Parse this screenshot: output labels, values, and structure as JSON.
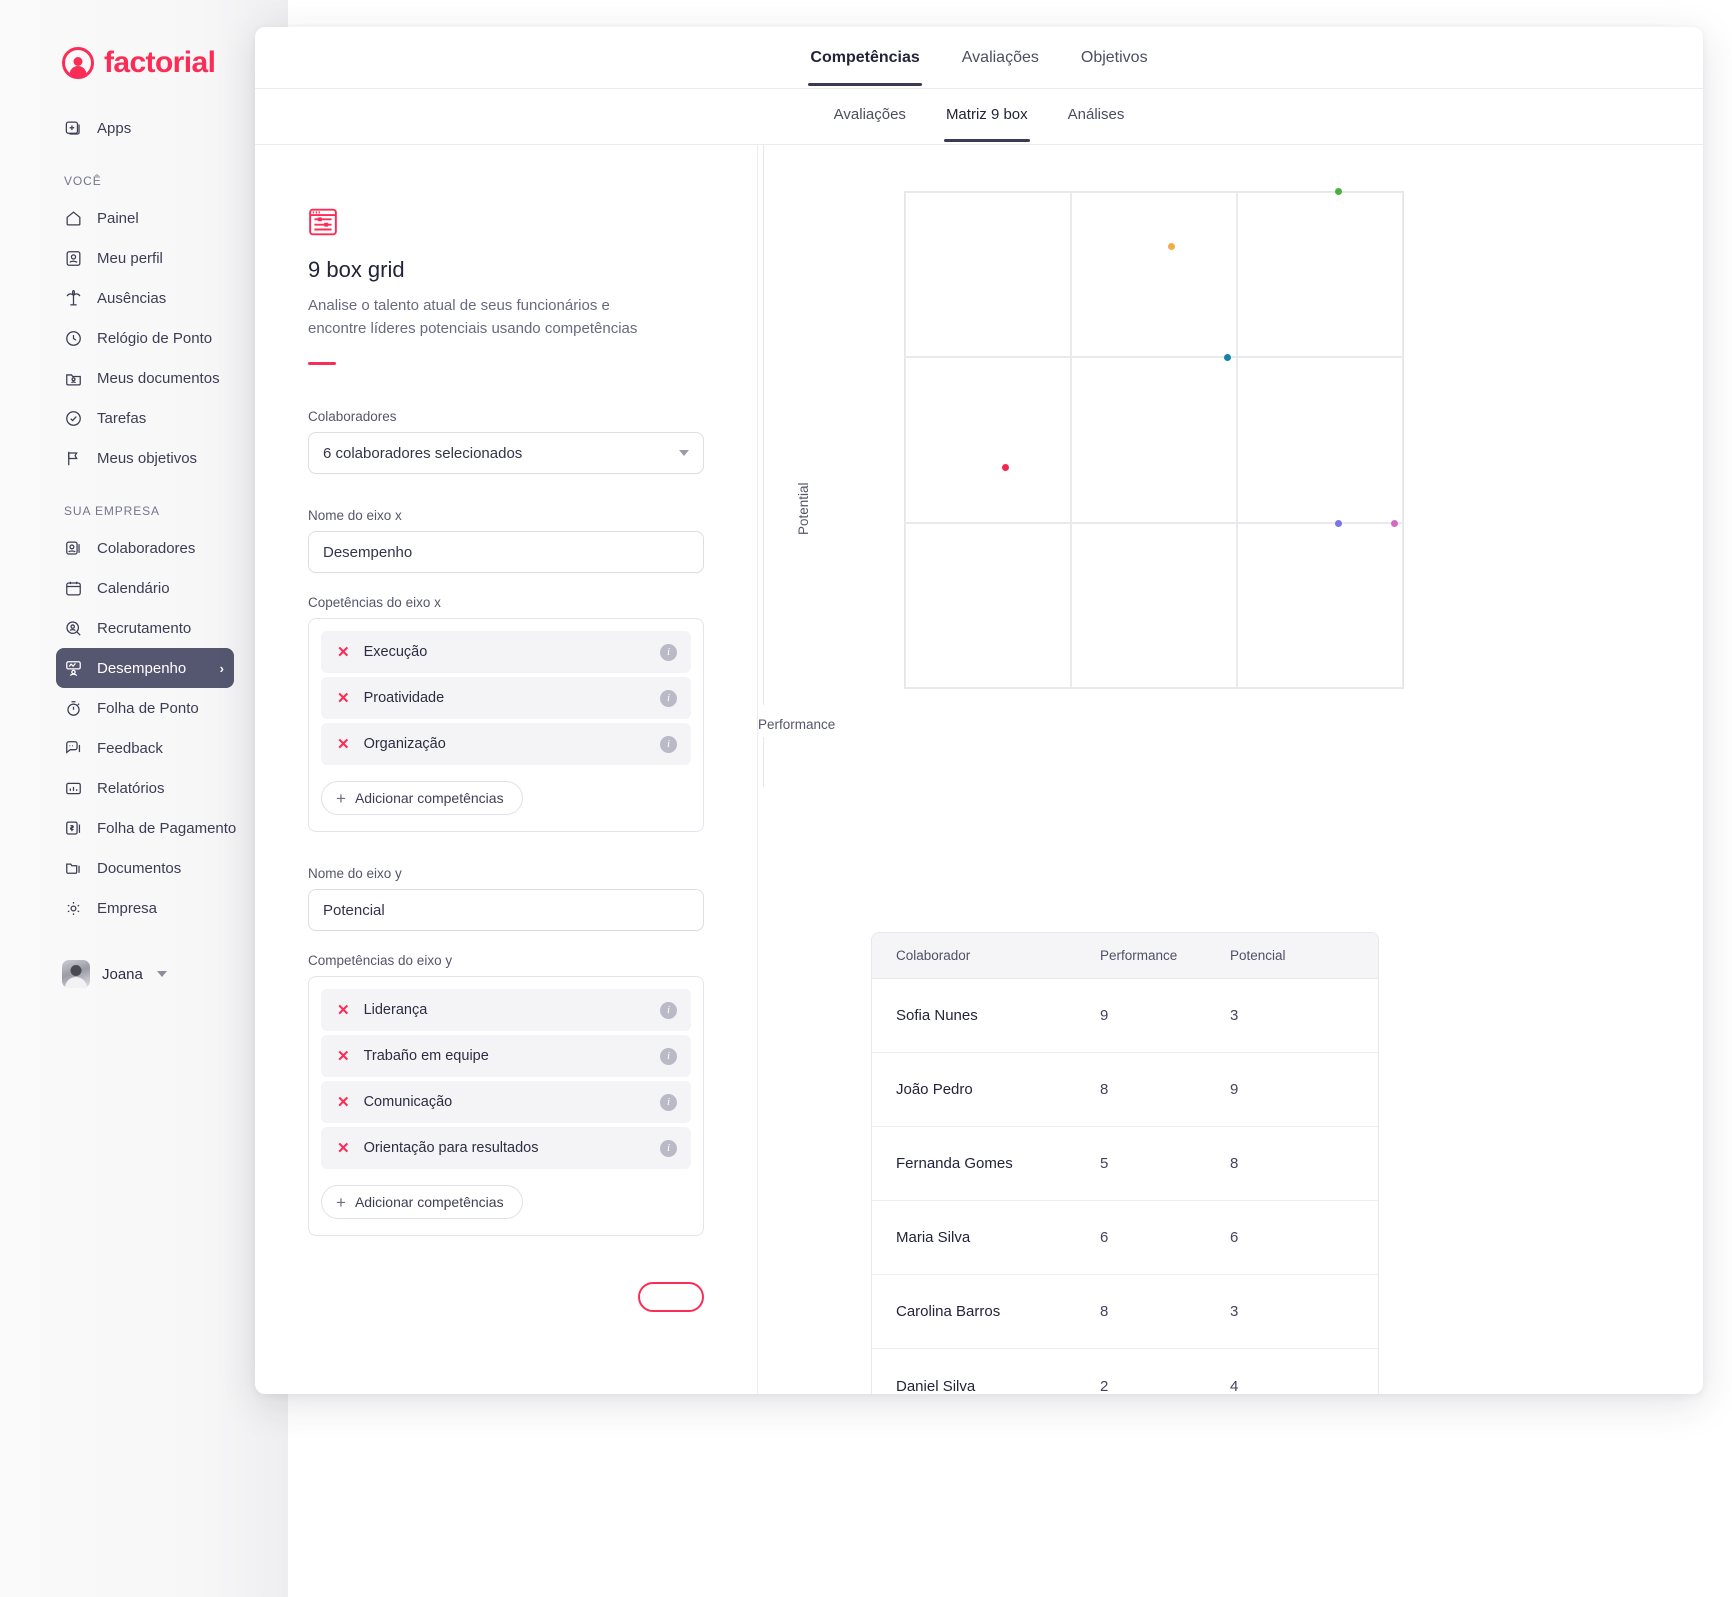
{
  "brand": {
    "name": "factorial"
  },
  "sidebar": {
    "apps_label": "Apps",
    "section_you": "VOCÊ",
    "section_company": "SUA EMPRESA",
    "you_items": [
      {
        "label": "Painel",
        "icon": "home-icon"
      },
      {
        "label": "Meu perfil",
        "icon": "user-card-icon"
      },
      {
        "label": "Ausências",
        "icon": "palm-tree-icon"
      },
      {
        "label": "Relógio de Ponto",
        "icon": "clock-icon"
      },
      {
        "label": "Meus documentos",
        "icon": "folder-user-icon"
      },
      {
        "label": "Tarefas",
        "icon": "check-circle-icon"
      },
      {
        "label": "Meus objetivos",
        "icon": "flag-icon"
      }
    ],
    "company_items": [
      {
        "label": "Colaboradores",
        "icon": "users-icon",
        "active": false
      },
      {
        "label": "Calendário",
        "icon": "calendar-icon",
        "active": false
      },
      {
        "label": "Recrutamento",
        "icon": "search-user-icon",
        "active": false
      },
      {
        "label": "Desempenho",
        "icon": "performance-icon",
        "active": true
      },
      {
        "label": "Folha de Ponto",
        "icon": "timer-icon",
        "active": false
      },
      {
        "label": "Feedback",
        "icon": "chat-icon",
        "active": false
      },
      {
        "label": "Relatórios",
        "icon": "bar-chart-icon",
        "active": false
      },
      {
        "label": "Folha de Pagamento",
        "icon": "money-icon",
        "active": false
      },
      {
        "label": "Documentos",
        "icon": "folder-icon",
        "active": false
      },
      {
        "label": "Empresa",
        "icon": "gear-icon",
        "active": false
      }
    ],
    "active_chevron": "›",
    "user": {
      "name": "Joana"
    }
  },
  "tabs_top": [
    {
      "label": "Competências",
      "active": true
    },
    {
      "label": "Avaliações",
      "active": false
    },
    {
      "label": "Objetivos",
      "active": false
    }
  ],
  "tabs_sub": [
    {
      "label": "Avaliações",
      "active": false
    },
    {
      "label": "Matriz 9 box",
      "active": true
    },
    {
      "label": "Análises",
      "active": false
    }
  ],
  "panel": {
    "icon": "nine-box-grid-icon",
    "title": "9 box grid",
    "description": "Analise o talento atual de seus funcionários e encontre líderes potenciais usando competências",
    "collaborators_label": "Colaboradores",
    "collaborators_value": "6 colaboradores selecionados",
    "x_axis_name_label": "Nome do eixo x",
    "x_axis_name_value": "Desempenho",
    "x_comp_label": "Copetências do eixo x",
    "x_competencies": [
      "Execução",
      "Proatividade",
      "Organização"
    ],
    "y_axis_name_label": "Nome do eixo y",
    "y_axis_name_value": "Potencial",
    "y_comp_label": "Competências do eixo y",
    "y_competencies": [
      "Liderança",
      "Trabaño em equipe",
      "Comunicação",
      "Orientação para resultados"
    ],
    "add_competencies_label": "Adicionar competências",
    "submit_label": ""
  },
  "table": {
    "headers": [
      "Colaborador",
      "Performance",
      "Potencial"
    ],
    "rows": [
      {
        "name": "Sofia Nunes",
        "performance": "9",
        "potencial": "3"
      },
      {
        "name": "João Pedro",
        "performance": "8",
        "potencial": "9"
      },
      {
        "name": "Fernanda Gomes",
        "performance": "5",
        "potencial": "8"
      },
      {
        "name": "Maria Silva",
        "performance": "6",
        "potencial": "6"
      },
      {
        "name": "Carolina Barros",
        "performance": "8",
        "potencial": "3"
      },
      {
        "name": "Daniel Silva",
        "performance": "2",
        "potencial": "4"
      }
    ]
  },
  "chart_data": {
    "type": "scatter",
    "title": "",
    "xlabel": "Performance",
    "ylabel": "Potential",
    "xlim": [
      0,
      9
    ],
    "ylim": [
      0,
      9
    ],
    "grid": true,
    "grid_rows": 3,
    "grid_cols": 3,
    "legend": "none",
    "points": [
      {
        "name": "Sofia Nunes",
        "x": 9,
        "y": 3,
        "color": "#d469c4"
      },
      {
        "name": "João Pedro",
        "x": 8,
        "y": 9,
        "color": "#4caf3f"
      },
      {
        "name": "Fernanda Gomes",
        "x": 5,
        "y": 8,
        "color": "#f0ab4a"
      },
      {
        "name": "Maria Silva",
        "x": 6,
        "y": 6,
        "color": "#1284a8"
      },
      {
        "name": "Carolina Barros",
        "x": 8,
        "y": 3,
        "color": "#7b74e8"
      },
      {
        "name": "Daniel Silva",
        "x": 2,
        "y": 4,
        "color": "#f5264f"
      }
    ]
  },
  "colors": {
    "brand": "#fb2c55",
    "sidebar_active": "#55566f",
    "text": "#23243a",
    "muted": "#686a80"
  }
}
